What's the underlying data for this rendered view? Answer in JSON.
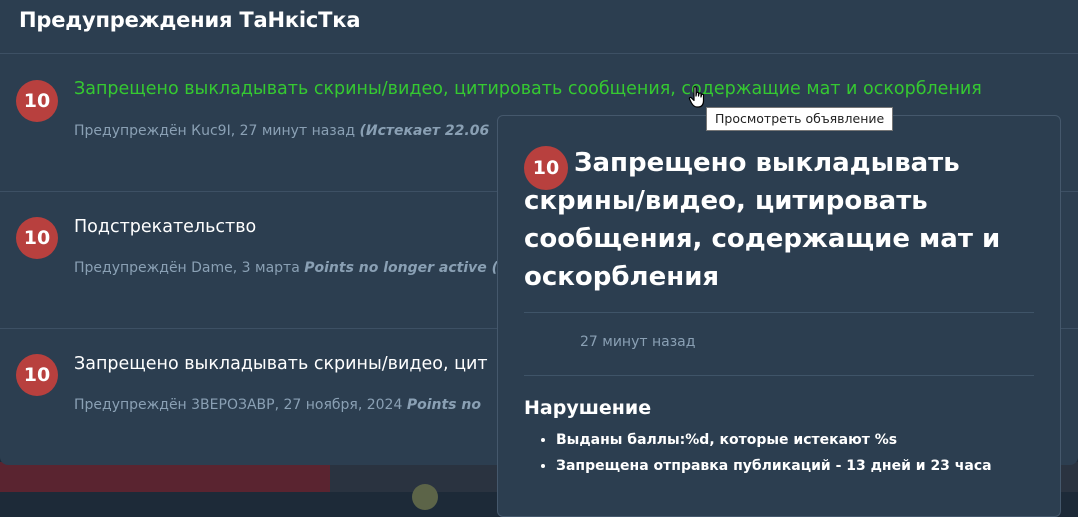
{
  "panel": {
    "title": "Предупреждения ТаНкісТка"
  },
  "warnings": [
    {
      "points": "10",
      "title": "Запрещено выкладывать скрины/видео, цитировать сообщения, содержащие мат и оскорбления",
      "meta": "Предупреждён Кuc9I, 27 минут назад",
      "note": "(Истекает 22.06"
    },
    {
      "points": "10",
      "title": "Подстрекательство",
      "meta": "Предупреждён Dame, 3 марта",
      "note": "Points no longer active ("
    },
    {
      "points": "10",
      "title": "Запрещено выкладывать скрины/видео, цит",
      "meta": "Предупреждён 3ВЕРОЗАВР, 27 ноября, 2024",
      "note": "Points no"
    }
  ],
  "tooltip": {
    "text": "Просмотреть объявление"
  },
  "popover": {
    "points": "10",
    "title": "Запрещено выкладывать скрины/видео, цитировать сообщения, содержащие мат и оскорбления",
    "time": "27 минут назад",
    "section_title": "Нарушение",
    "items": [
      "Выданы баллы:%d, которые истекают %s",
      "Запрещена отправка публикаций - 13 дней и 23 часа"
    ]
  },
  "colors": {
    "panel_bg": "#2c3e50",
    "badge": "#b8403e",
    "link_green": "#35c931",
    "meta_text": "#8aa0b4"
  },
  "icons": {
    "cursor": "hand-pointer-icon"
  }
}
